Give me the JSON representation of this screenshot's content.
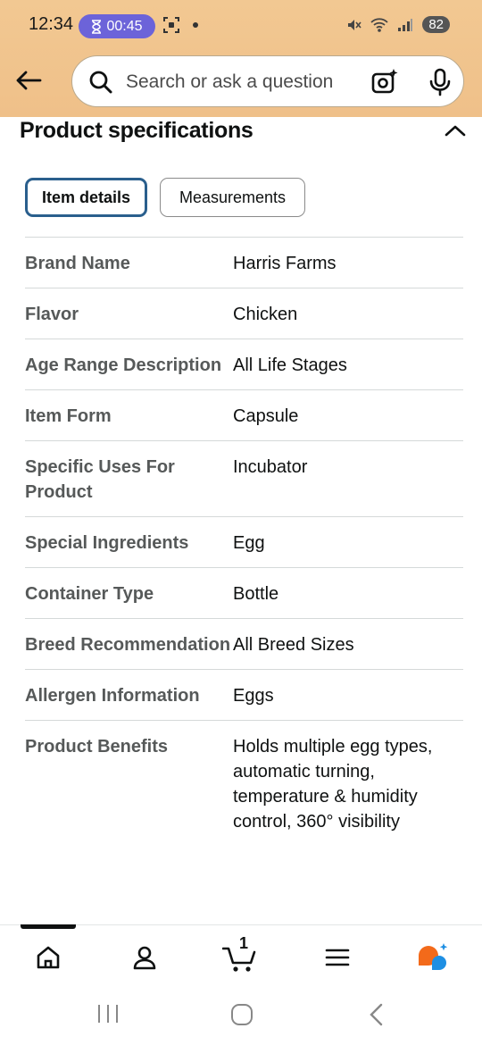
{
  "status_bar": {
    "time": "12:34",
    "timer": "00:45",
    "battery": "82"
  },
  "search": {
    "placeholder": "Search or ask a question"
  },
  "section": {
    "title": "Product specifications"
  },
  "tabs": [
    {
      "label": "Item details",
      "active": true
    },
    {
      "label": "Measurements",
      "active": false
    }
  ],
  "specs": [
    {
      "key": "Brand Name",
      "value": "Harris Farms"
    },
    {
      "key": "Flavor",
      "value": "Chicken"
    },
    {
      "key": "Age Range Description",
      "value": "All Life Stages"
    },
    {
      "key": "Item Form",
      "value": "Capsule"
    },
    {
      "key": "Specific Uses For Product",
      "value": "Incubator"
    },
    {
      "key": "Special Ingredients",
      "value": "Egg"
    },
    {
      "key": "Container Type",
      "value": "Bottle"
    },
    {
      "key": "Breed Recommendation",
      "value": "All Breed Sizes"
    },
    {
      "key": "Allergen Information",
      "value": "Eggs"
    },
    {
      "key": "Product Benefits",
      "value": "Holds multiple egg types, automatic turning, temperature & humidity control, 360° visibility"
    }
  ],
  "bottom_nav": {
    "cart_count": "1",
    "items": [
      "home-icon",
      "account-icon",
      "cart-icon",
      "menu-icon",
      "rufus-icon"
    ]
  },
  "colors": {
    "header_bg": "#efc089",
    "active_tab_border": "#2a5f8d",
    "timer_bg": "#6c63d9",
    "rufus_orange": "#f36a1a",
    "rufus_blue": "#1e8fe3"
  }
}
